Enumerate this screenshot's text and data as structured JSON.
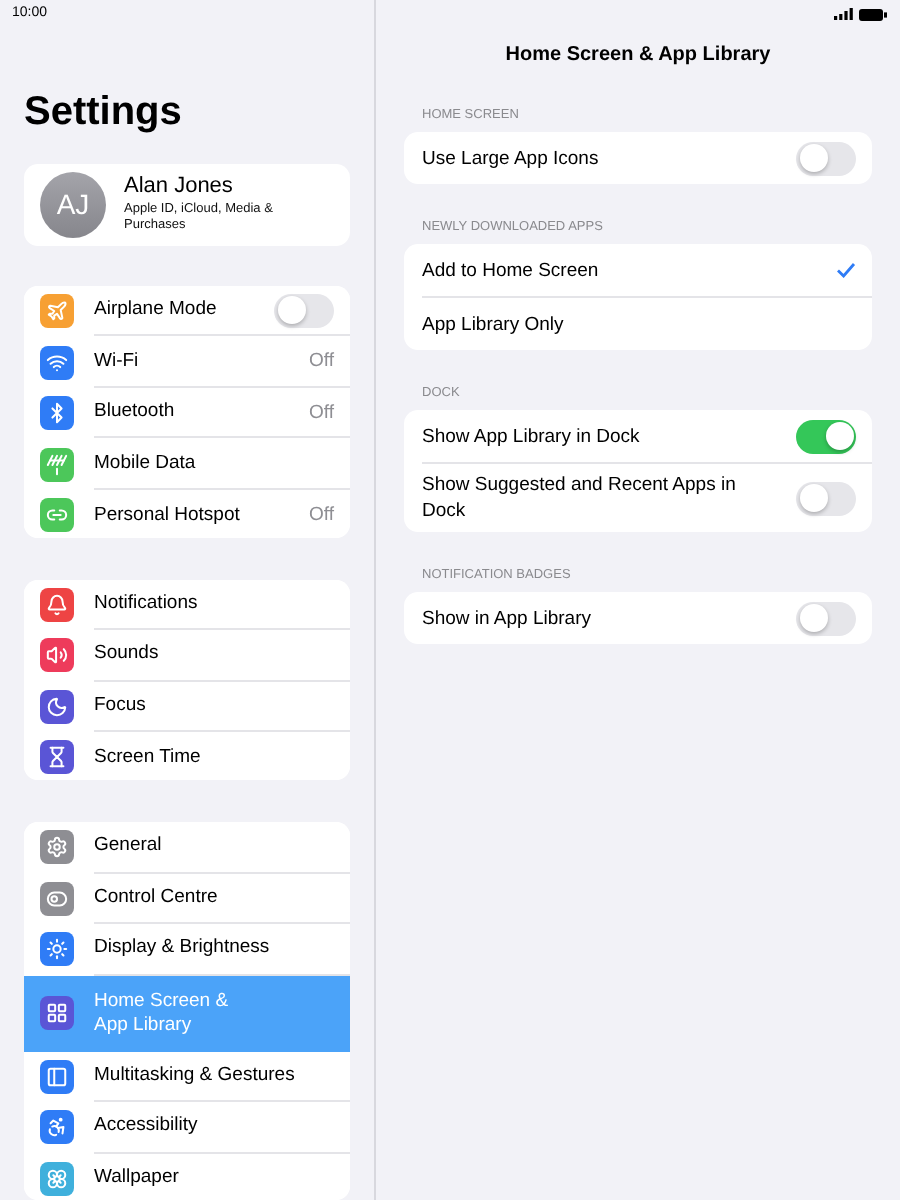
{
  "status_bar": {
    "time": "10:00"
  },
  "sidebar": {
    "title": "Settings",
    "account": {
      "initials": "AJ",
      "name": "Alan Jones",
      "subtitle": "Apple ID, iCloud, Media & Purchases"
    },
    "groups": [
      [
        {
          "label": "Airplane Mode",
          "color": "#f7a033",
          "kind": "toggle",
          "on": false,
          "selected": false
        },
        {
          "label": "Wi-Fi",
          "color": "#2f7cf6",
          "kind": "value",
          "value": "Off",
          "selected": false
        },
        {
          "label": "Bluetooth",
          "color": "#2f7cf6",
          "kind": "value",
          "value": "Off",
          "selected": false
        },
        {
          "label": "Mobile Data",
          "color": "#4cc75a",
          "kind": "link",
          "selected": false
        },
        {
          "label": "Personal Hotspot",
          "color": "#4cc75a",
          "kind": "value",
          "value": "Off",
          "selected": false
        }
      ],
      [
        {
          "label": "Notifications",
          "color": "#ee4444",
          "kind": "link",
          "selected": false
        },
        {
          "label": "Sounds",
          "color": "#ee3b5b",
          "kind": "link",
          "selected": false
        },
        {
          "label": "Focus",
          "color": "#5a55d6",
          "kind": "link",
          "selected": false
        },
        {
          "label": "Screen Time",
          "color": "#5a55d6",
          "kind": "link",
          "selected": false
        }
      ],
      [
        {
          "label": "General",
          "color": "#8e8e93",
          "kind": "link",
          "selected": false
        },
        {
          "label": "Control Centre",
          "color": "#8e8e93",
          "kind": "link",
          "selected": false
        },
        {
          "label": "Display & Brightness",
          "color": "#2f7cf6",
          "kind": "link",
          "selected": false
        },
        {
          "label": "Home Screen & App Library",
          "color": "#5a55d6",
          "kind": "link",
          "selected": true
        },
        {
          "label": "Multitasking & Gestures",
          "color": "#2f7cf6",
          "kind": "link",
          "selected": false
        },
        {
          "label": "Accessibility",
          "color": "#2f7cf6",
          "kind": "link",
          "selected": false
        },
        {
          "label": "Wallpaper",
          "color": "#3fb0dc",
          "kind": "link",
          "selected": false
        }
      ]
    ]
  },
  "detail": {
    "title": "Home Screen & App Library",
    "sections": [
      {
        "header": "HOME SCREEN",
        "rows": [
          {
            "label": "Use Large App Icons",
            "kind": "toggle",
            "on": false
          }
        ]
      },
      {
        "header": "NEWLY DOWNLOADED APPS",
        "rows": [
          {
            "label": "Add to Home Screen",
            "kind": "choice",
            "selected": true
          },
          {
            "label": "App Library Only",
            "kind": "choice",
            "selected": false
          }
        ]
      },
      {
        "header": "DOCK",
        "rows": [
          {
            "label": "Show App Library in Dock",
            "kind": "toggle",
            "on": true
          },
          {
            "label": "Show Suggested and Recent Apps in Dock",
            "kind": "toggle",
            "on": false
          }
        ]
      },
      {
        "header": "NOTIFICATION BADGES",
        "rows": [
          {
            "label": "Show in App Library",
            "kind": "toggle",
            "on": false
          }
        ]
      }
    ]
  }
}
